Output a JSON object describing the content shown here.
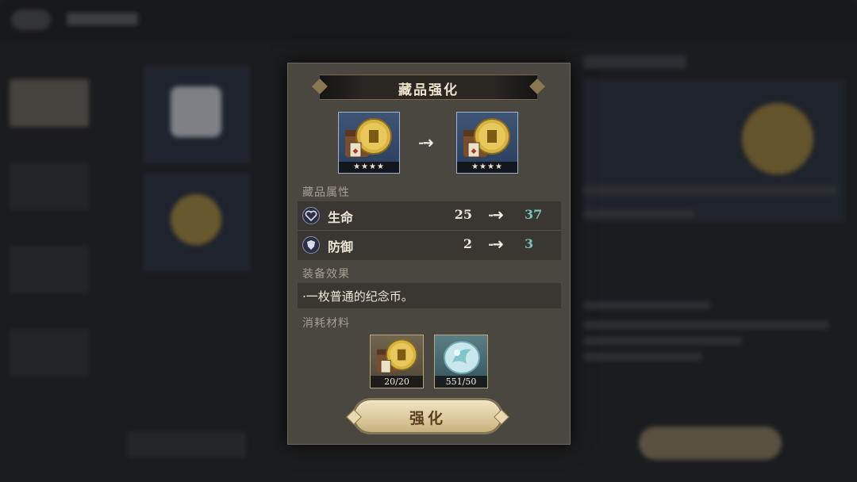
{
  "dialog": {
    "title": "藏品强化",
    "current_item": {
      "stars": "★★★★",
      "icon": "coin-icon"
    },
    "next_item": {
      "stars": "★★★★",
      "icon": "coin-icon"
    },
    "attributes_label": "藏品属性",
    "stats": [
      {
        "name": "生命",
        "old": "25",
        "new": "37",
        "icon": "heart-icon"
      },
      {
        "name": "防御",
        "old": "2",
        "new": "3",
        "icon": "shield-icon"
      }
    ],
    "effect_label": "装备效果",
    "effect_text": "·一枚普通的纪念币。",
    "materials_label": "消耗材料",
    "materials": [
      {
        "count": "20/20",
        "icon": "coin-icon"
      },
      {
        "count": "551/50",
        "icon": "crystal-icon"
      }
    ],
    "enhance_button": "强化"
  },
  "colors": {
    "stat_new_value": "#79c3b8",
    "dialog_bg": "#4a4640",
    "button_gold": "#ddcb9f"
  }
}
